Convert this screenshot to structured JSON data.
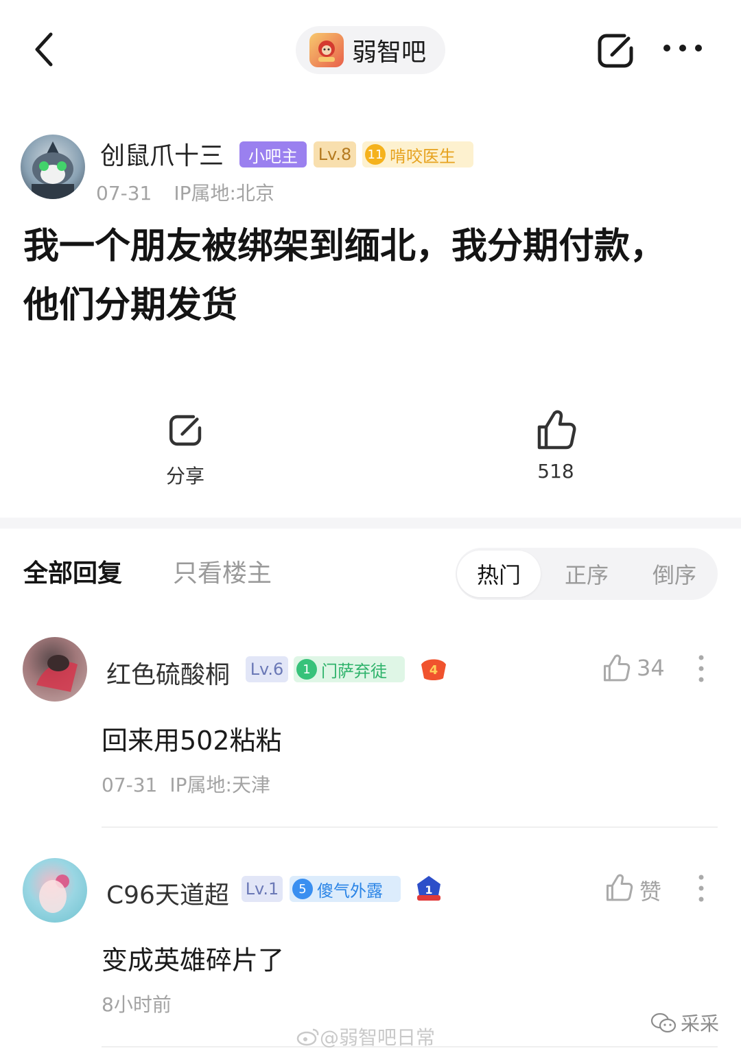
{
  "header": {
    "forum_name": "弱智吧",
    "icons": [
      "back-icon",
      "share-icon",
      "more-icon"
    ]
  },
  "author": {
    "name": "创鼠爪十三",
    "role_badge": "小吧主",
    "level": "Lv.8",
    "title_level": "11",
    "title": "啃咬医生",
    "date": "07-31",
    "ip": "IP属地:北京"
  },
  "post": {
    "title": "我一个朋友被绑架到缅北，我分期付款，他们分期发货"
  },
  "actions": {
    "share_label": "分享",
    "like_count": "518"
  },
  "tabs": {
    "all": "全部回复",
    "owner_only": "只看楼主",
    "sort": [
      "热门",
      "正序",
      "倒序"
    ],
    "active_sort": "热门"
  },
  "comments": [
    {
      "name": "红色硫酸桐",
      "level": "Lv.6",
      "title_level": "1",
      "title": "门萨弃徒",
      "medal": "4",
      "like": "34",
      "text": "回来用502粘粘",
      "date": "07-31",
      "ip": "IP属地:天津"
    },
    {
      "name": "C96天道超",
      "level": "Lv.1",
      "title_level": "5",
      "title": "傻气外露",
      "medal": "1",
      "like": "赞",
      "text": "变成英雄碎片了",
      "date": "8小时前"
    }
  ],
  "watermarks": {
    "weibo": "@弱智吧日常",
    "wechat": "采采"
  },
  "colors": {
    "owner_badge": "#9a80ef",
    "level_badge": "#f8dfae",
    "title_gold": "#e6a21e",
    "title_green": "#2fb36b",
    "title_blue": "#2a84e6"
  }
}
